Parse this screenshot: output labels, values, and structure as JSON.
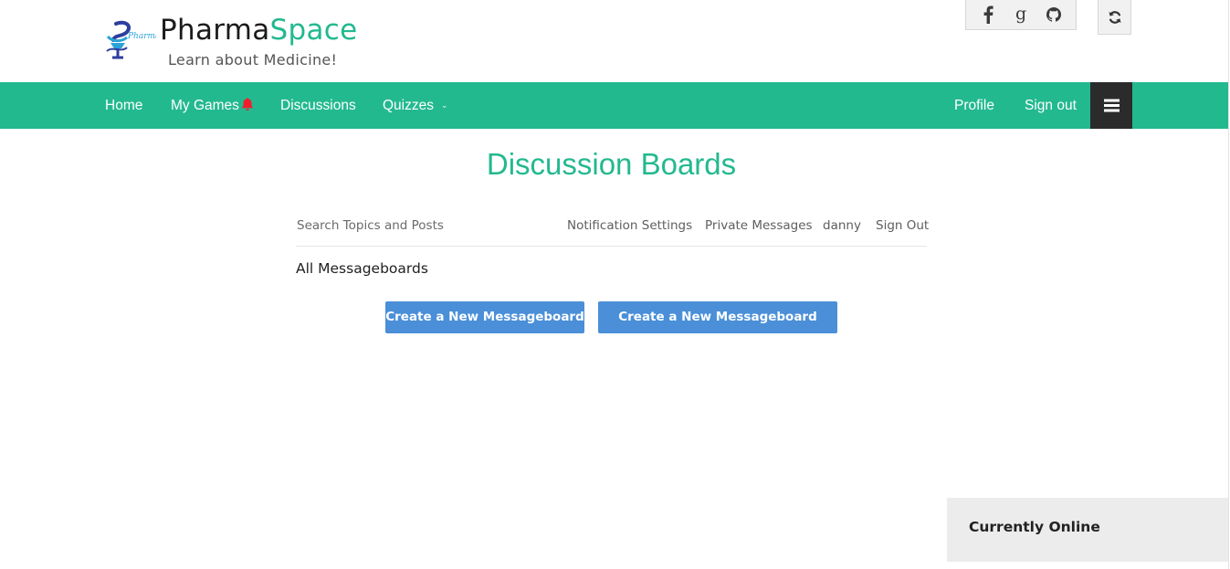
{
  "brand": {
    "name_part1": "Pharma",
    "name_part2": "Space",
    "tagline": "Learn about Medicine!",
    "logo_text": "Pharma Space",
    "accent_color": "#23b98f"
  },
  "social": [
    {
      "icon": "facebook-icon"
    },
    {
      "icon": "google-icon"
    },
    {
      "icon": "github-icon"
    }
  ],
  "refresh_icon": "refresh-icon",
  "nav": {
    "home": "Home",
    "my_games": "My Games",
    "discussions": "Discussions",
    "quizzes": "Quizzes",
    "profile": "Profile",
    "sign_out": "Sign out",
    "bar_color": "#23b98f",
    "notification_icon": "bell-icon",
    "menu_icon": "hamburger-icon"
  },
  "board": {
    "title": "Discussion Boards",
    "search_placeholder": "Search Topics and Posts",
    "links": {
      "notification_settings": "Notification Settings",
      "private_messages": "Private Messages",
      "username": "danny",
      "sign_out": "Sign Out"
    },
    "section_title": "All Messageboards",
    "create_board_label": "Create a New Messageboard",
    "create_group_label": "Create a New Messageboard Group",
    "button_color": "#4a8fd8"
  },
  "online": {
    "title": "Currently Online"
  }
}
